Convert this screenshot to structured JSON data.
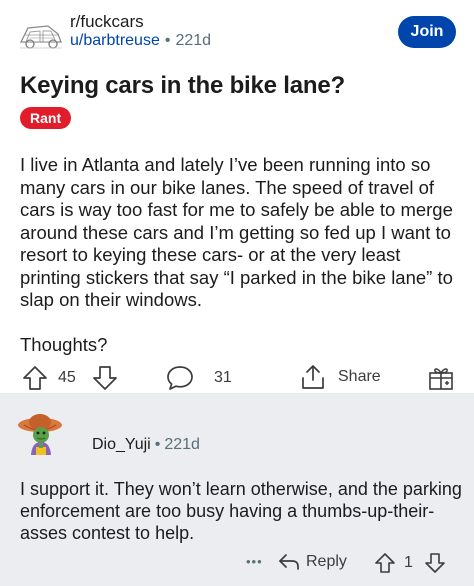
{
  "post": {
    "subreddit": "r/fuckcars",
    "author": "u/barbtreuse",
    "separator": "•",
    "age": "221d",
    "join_label": "Join",
    "title": "Keying cars in the bike lane?",
    "flair": "Rant",
    "paragraphs": [
      "I live in Atlanta and lately I’ve been running into so many cars in our bike lanes. The speed of travel of cars is way too fast for me to safely be able to merge around these cars and I’m getting so fed up I want to resort to keying these cars- or at the very least printing stickers that say “I parked in the bike lane” to slap on their windows.",
      "Thoughts?"
    ],
    "actions": {
      "upvote_count": "45",
      "comment_count": "31",
      "share_label": "Share"
    }
  },
  "comment": {
    "author": "Dio_Yuji",
    "separator": "•",
    "age": "221d",
    "body": "I support it. They won’t learn otherwise, and the parking enforcement are too busy having a thumbs-up-their-asses contest to help.",
    "more_label": "•••",
    "reply_label": "Reply",
    "vote_count": "1"
  },
  "icons": {
    "upvote": "arrow-up-icon",
    "downvote": "arrow-down-icon",
    "comment": "speech-bubble-icon",
    "share": "share-icon",
    "award": "award-icon",
    "reply": "reply-arrow-icon",
    "more": "ellipsis-icon"
  },
  "colors": {
    "join_button": "#0045ac",
    "author_link": "#0045ac",
    "flair": "#e11d2b",
    "comment_background": "#ecedf0"
  }
}
